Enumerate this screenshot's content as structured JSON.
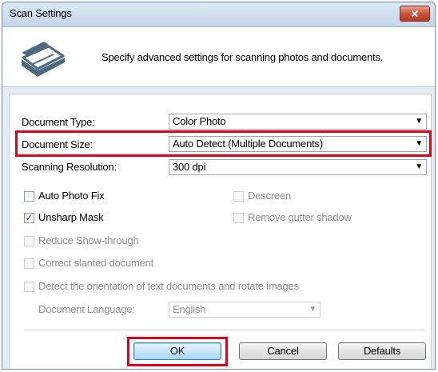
{
  "window": {
    "title": "Scan Settings",
    "close_label": "✕"
  },
  "header": {
    "description": "Specify advanced settings for scanning photos and documents."
  },
  "fields": {
    "document_type": {
      "label": "Document Type:",
      "value": "Color Photo"
    },
    "document_size": {
      "label": "Document Size:",
      "value": "Auto Detect (Multiple Documents)"
    },
    "scanning_resolution": {
      "label": "Scanning Resolution:",
      "value": "300 dpi"
    },
    "document_language": {
      "label": "Document Language:",
      "value": "English"
    }
  },
  "checkboxes": {
    "auto_photo_fix": {
      "label": "Auto Photo Fix",
      "checked": false,
      "enabled": true
    },
    "unsharp_mask": {
      "label": "Unsharp Mask",
      "checked": true,
      "enabled": true
    },
    "descreen": {
      "label": "Descreen",
      "checked": false,
      "enabled": false
    },
    "remove_gutter_shadow": {
      "label": "Remove gutter shadow",
      "checked": false,
      "enabled": false
    },
    "reduce_show_through": {
      "label": "Reduce Show-through",
      "checked": false,
      "enabled": false
    },
    "correct_slanted_document": {
      "label": "Correct slanted document",
      "checked": false,
      "enabled": false
    },
    "detect_orientation": {
      "label": "Detect the orientation of text documents and rotate images",
      "checked": false,
      "enabled": false
    }
  },
  "buttons": {
    "ok": "OK",
    "cancel": "Cancel",
    "defaults": "Defaults"
  },
  "colors": {
    "highlight": "#e2001a",
    "title_bar": "#c4d6ea",
    "close_button": "#c7553c"
  }
}
